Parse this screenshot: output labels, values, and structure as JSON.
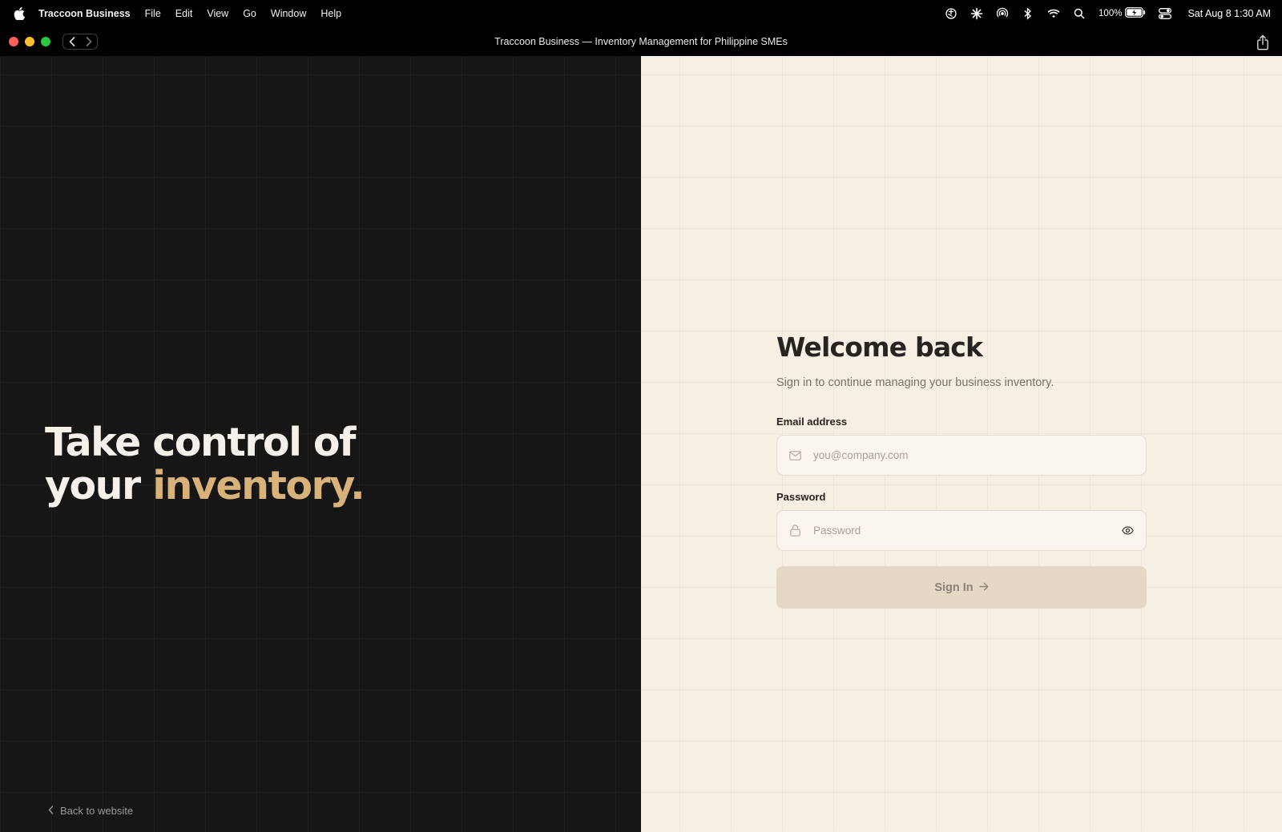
{
  "menubar": {
    "app_name": "Traccoon Business",
    "menus": [
      "File",
      "Edit",
      "View",
      "Go",
      "Window",
      "Help"
    ],
    "battery_percent": "100%",
    "datetime": "Sat Aug 8  1:30 AM",
    "status_icons": [
      "chatgpt-icon",
      "claude-icon",
      "airdrop-icon",
      "bluetooth-icon",
      "wifi-icon",
      "search-icon",
      "battery-icon",
      "control-center-icon"
    ]
  },
  "window": {
    "title": "Traccoon Business — Inventory Management for Philippine SMEs"
  },
  "hero": {
    "line1": "Take control of",
    "line2_prefix": "your ",
    "line2_accent": "inventory.",
    "accent_color": "#d9b27a"
  },
  "back_link": {
    "label": "Back to website"
  },
  "login": {
    "title": "Welcome back",
    "subtitle": "Sign in to continue managing your business inventory.",
    "email_label": "Email address",
    "email_placeholder": "you@company.com",
    "email_value": "",
    "password_label": "Password",
    "password_placeholder": "Password",
    "password_value": "",
    "submit_label": "Sign In"
  },
  "colors": {
    "dark_panel": "#161616",
    "light_panel": "#f6efe4",
    "button_bg": "#e5d9c5",
    "traffic_close": "#ff5f57",
    "traffic_minimize": "#febc2e",
    "traffic_maximize": "#28c840"
  }
}
